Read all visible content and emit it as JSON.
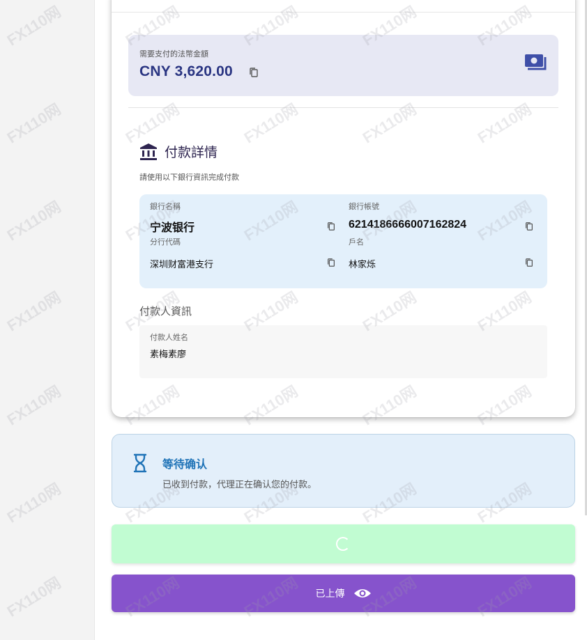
{
  "amount": {
    "label": "需要支付的法幣金額",
    "value": "CNY 3,620.00"
  },
  "payment_details": {
    "title": "付款詳情",
    "subtitle": "請使用以下銀行資訊完成付款",
    "bank_name_label": "銀行名稱",
    "bank_name": "宁波银行",
    "account_number_label": "銀行帳號",
    "account_number": "6214186666007162824",
    "branch_code_label": "分行代碼",
    "branch": "深圳财富港支行",
    "account_holder_label": "戶名",
    "account_holder": "林家烁"
  },
  "payer": {
    "heading": "付款人資訊",
    "name_label": "付款人姓名",
    "name": "素梅素廖"
  },
  "status": {
    "title": "等待确认",
    "description": "已收到付款，代理正在确认您的付款。"
  },
  "upload_button": {
    "label": "已上傳"
  },
  "watermark": {
    "text": "FX110网"
  },
  "colors": {
    "amount_text": "#2a3582",
    "status_title": "#1f73b7",
    "submit_button": "#c1fcd2",
    "upload_button": "#8653cc",
    "bank_box": "#e3f0fb"
  }
}
